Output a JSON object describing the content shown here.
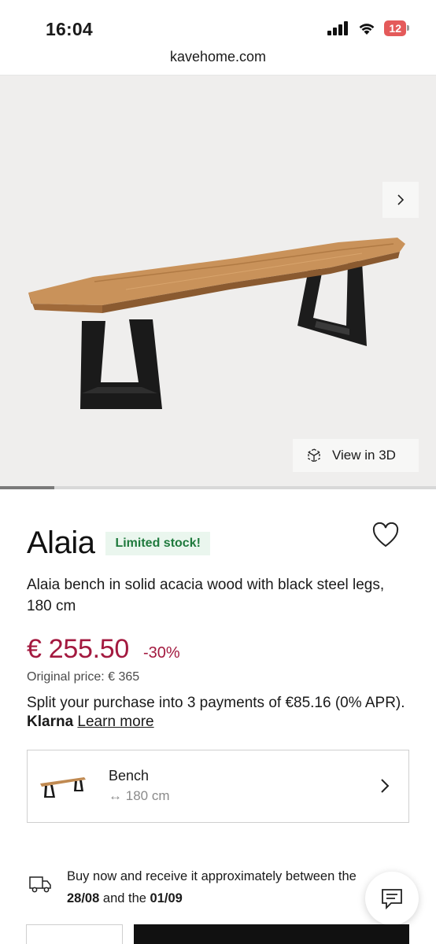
{
  "status_bar": {
    "time": "16:04",
    "battery": "12",
    "icons": [
      "signal-icon",
      "wifi-icon",
      "battery-icon"
    ]
  },
  "browser": {
    "url": "kavehome.com"
  },
  "gallery": {
    "next_icon": "chevron-right-icon",
    "view_3d_label": "View in 3D",
    "view_3d_icon": "3d-cube-icon",
    "progress_fraction": 0.125
  },
  "product": {
    "title": "Alaia",
    "stock_badge": "Limited stock!",
    "description": "Alaia bench in solid acacia wood with black steel legs, 180 cm",
    "price": "€ 255.50",
    "discount": "-30%",
    "original_price": "Original price: € 365",
    "klarna": {
      "text": "Split your purchase into 3 payments of €85.16 (0% APR).",
      "brand": "Klarna",
      "link": "Learn more"
    }
  },
  "variant": {
    "name": "Bench",
    "size_icon": "↔",
    "size": "180 cm"
  },
  "delivery": {
    "prefix": "Buy now and receive it approximately between the",
    "date_from": "28/08",
    "connector": "and the",
    "date_to": "01/09"
  },
  "colors": {
    "price": "#a3193f",
    "stock_badge_bg": "#eaf6ee",
    "stock_badge_text": "#1f7a3d",
    "hero_bg": "#efeeed",
    "battery": "#e45a5a"
  }
}
